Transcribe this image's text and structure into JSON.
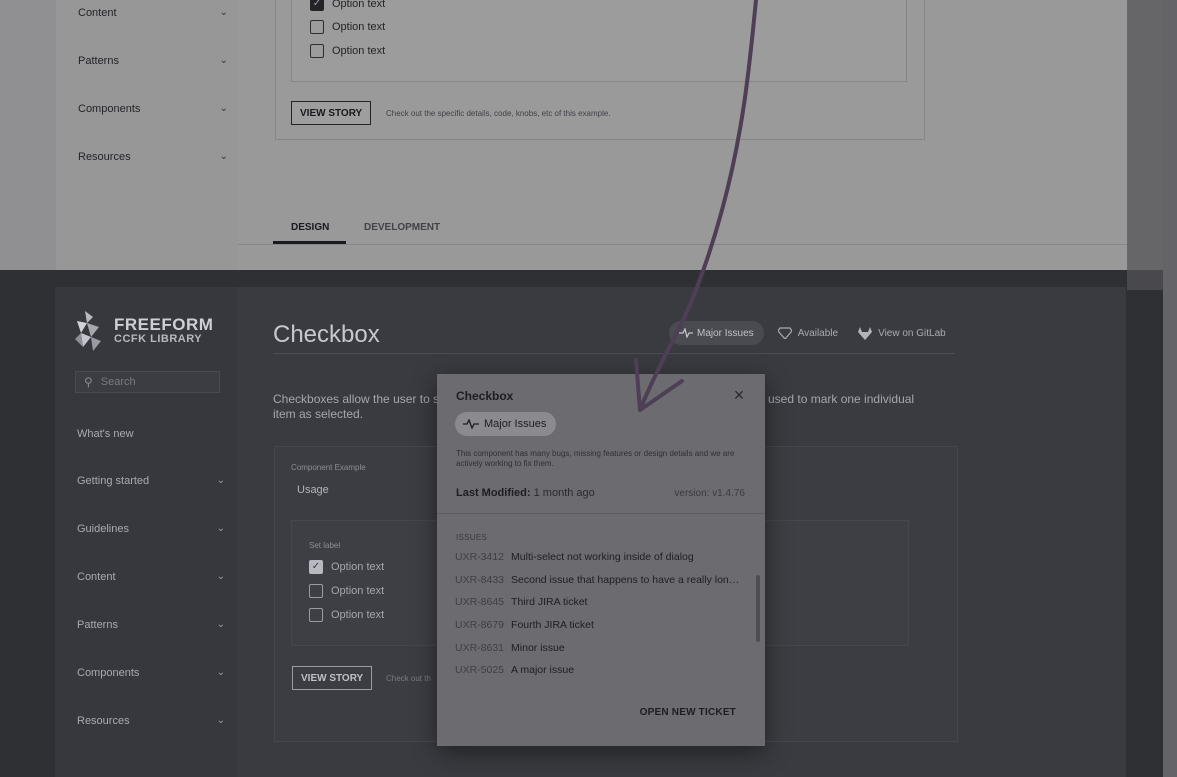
{
  "top": {
    "nav": [
      "Content",
      "Patterns",
      "Components",
      "Resources"
    ],
    "checkboxes": [
      {
        "label": "Option text",
        "checked": true
      },
      {
        "label": "Option text",
        "checked": false
      },
      {
        "label": "Option text",
        "checked": false
      }
    ],
    "view_story": "VIEW STORY",
    "view_story_hint": "Check out the specific details, code, knobs, etc of this example.",
    "tabs": [
      "DESIGN",
      "DEVELOPMENT"
    ]
  },
  "bottom": {
    "logo_title": "FREEFORM",
    "logo_sub": "CCFK LIBRARY",
    "search_placeholder": "Search",
    "nav": [
      "What's new",
      "Getting started",
      "Guidelines",
      "Content",
      "Patterns",
      "Components",
      "Resources"
    ],
    "nav_has_chevron": [
      false,
      true,
      true,
      true,
      true,
      true,
      true
    ],
    "page_title": "Checkbox",
    "status": {
      "major_issues": "Major Issues",
      "available": "Available",
      "gitlab": "View on GitLab"
    },
    "description_left": "Checkboxes allow the user to s",
    "description_left_2": "item as selected.",
    "description_right": "used to mark one individual",
    "component_example_label": "Component Example",
    "select_value": "Usage",
    "set_label": "Set label",
    "checkboxes": [
      {
        "label": "Option text",
        "checked": true
      },
      {
        "label": "Option text",
        "checked": false
      },
      {
        "label": "Option text",
        "checked": false
      }
    ],
    "view_story": "VIEW STORY",
    "view_story_hint": "Check out th"
  },
  "dialog": {
    "title": "Checkbox",
    "badge": "Major Issues",
    "note": "This component has many bugs, missing features or design details and we are actively working to fix them.",
    "last_modified_label": "Last Modified:",
    "last_modified_value": "1 month ago",
    "version": "version: v1.4.76",
    "issues_heading": "ISSUES",
    "issues": [
      {
        "id": "UXR-3412",
        "text": "Multi-select not working inside of dialog"
      },
      {
        "id": "UXR-8433",
        "text": "Second issue that happens to have a really lon…"
      },
      {
        "id": "UXR-8645",
        "text": "Third JIRA ticket"
      },
      {
        "id": "UXR-8679",
        "text": "Fourth JIRA ticket"
      },
      {
        "id": "UXR-8631",
        "text": "Minor issue"
      },
      {
        "id": "UXR-5025",
        "text": "A major issue"
      }
    ],
    "action": "OPEN NEW TICKET"
  },
  "colors": {
    "arrow": "#4e3f56",
    "dialog_bg": "#6b6b70",
    "page_dark": "#3a3b40"
  }
}
